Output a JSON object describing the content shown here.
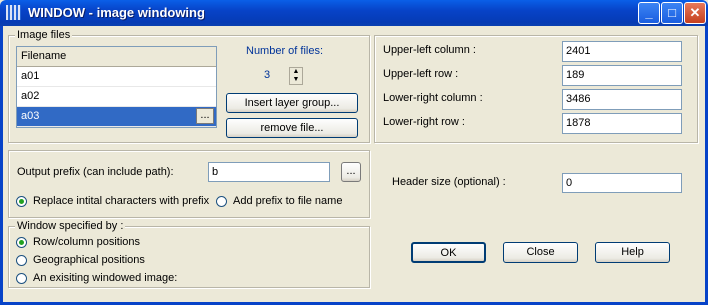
{
  "window": {
    "title": "WINDOW - image windowing",
    "minimize": "_",
    "maximize": "□",
    "close": "✕"
  },
  "image_files": {
    "legend": "Image files",
    "column_header": "Filename",
    "files": [
      "a01",
      "a02",
      "a03"
    ],
    "selected": "a03",
    "browse_label": "...",
    "num_files_label": "Number of files:",
    "num_files_value": "3",
    "insert_label": "Insert layer group...",
    "remove_label": "remove file..."
  },
  "coords": {
    "upper_left_column_label": "Upper-left column :",
    "upper_left_column_value": "2401",
    "upper_left_row_label": "Upper-left row :",
    "upper_left_row_value": "189",
    "lower_right_column_label": "Lower-right column :",
    "lower_right_column_value": "3486",
    "lower_right_row_label": "Lower-right row :",
    "lower_right_row_value": "1878"
  },
  "output": {
    "prefix_label": "Output prefix (can include path):",
    "prefix_value": "b",
    "browse_label": "...",
    "replace_label": "Replace intital characters with prefix",
    "add_label": "Add prefix to file name",
    "selected": "replace"
  },
  "header": {
    "label": "Header size (optional) :",
    "value": "0"
  },
  "window_spec": {
    "legend": "Window specified by :",
    "options": [
      "Row/column positions",
      "Geographical positions",
      "An exisiting windowed image:"
    ],
    "selected": "Row/column positions"
  },
  "buttons": {
    "ok": "OK",
    "close": "Close",
    "help": "Help"
  }
}
